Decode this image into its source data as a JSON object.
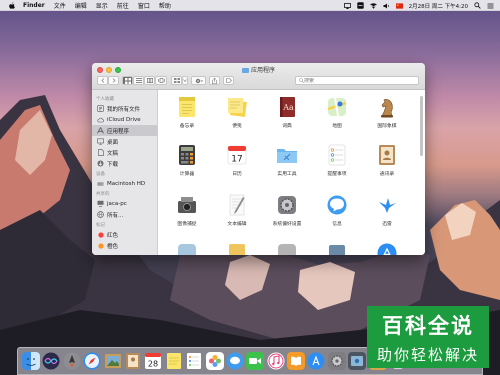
{
  "menubar": {
    "items": [
      "Finder",
      "文件",
      "编辑",
      "显示",
      "前往",
      "窗口",
      "帮助"
    ],
    "clock": "2月28日 周二 下午4:20"
  },
  "window": {
    "title": "应用程序",
    "search_placeholder": "搜索"
  },
  "sidebar": {
    "favorites_label": "个人收藏",
    "favorites": [
      "我的所有文件",
      "iCloud Drive",
      "应用程序",
      "桌面",
      "文稿",
      "下载"
    ],
    "devices_label": "设备",
    "devices": [
      "Macintosh HD"
    ],
    "shared_label": "共享的",
    "shared": [
      "jaca-pc",
      "所有..."
    ],
    "tags_label": "标记",
    "tags": [
      "红色",
      "橙色"
    ]
  },
  "apps": [
    "备忘录",
    "便笺",
    "词典",
    "地图",
    "国际象棋",
    "计算器",
    "日历",
    "实用工具",
    "提醒事项",
    "通讯录",
    "图像捕捉",
    "文本编辑",
    "系统偏好设置",
    "信息",
    "迅雷"
  ],
  "icons": {
    "dock": [
      "finder-icon",
      "siri-icon",
      "launchpad-icon",
      "safari-icon",
      "photo-preview-icon",
      "contacts-icon",
      "calendar-icon",
      "notes-icon",
      "reminders-icon",
      "photos-icon",
      "messages-icon",
      "facetime-icon",
      "itunes-icon",
      "ibooks-icon",
      "app-store-icon",
      "system-preferences-icon",
      "airdrop-folder-icon",
      "downloads-folder-icon",
      "trash-icon"
    ]
  },
  "dock": {
    "calendar_day": "28"
  },
  "watermark": {
    "line1": "百科全说",
    "line2": "助你轻松解决"
  }
}
